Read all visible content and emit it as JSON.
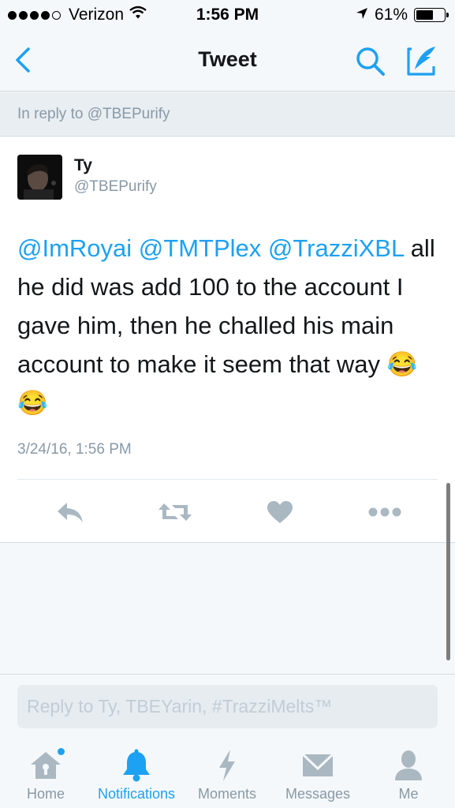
{
  "status_bar": {
    "carrier": "Verizon",
    "time": "1:56 PM",
    "battery_percent": "61%",
    "battery_level": 0.61,
    "signal_dots_filled": 4,
    "signal_dots_total": 5
  },
  "nav": {
    "title": "Tweet",
    "back_icon": "chevron-left-icon",
    "search_icon": "search-icon",
    "compose_icon": "compose-icon"
  },
  "reply_context": "In reply to @TBEPurify",
  "tweet": {
    "name": "Ty",
    "handle": "@TBEPurify",
    "mentions": [
      "@ImRoyai",
      "@TMTPlex",
      "@TrazziXBL"
    ],
    "body": "all he did was add 100 to the account I gave him, then he challed his main account to make it seem that way",
    "emoji": "😂😂",
    "timestamp": "3/24/16, 1:56 PM",
    "actions": [
      "reply-icon",
      "retweet-icon",
      "like-icon",
      "more-icon"
    ]
  },
  "composer": {
    "placeholder": "Reply to Ty, TBEYarin, #TrazziMelts™"
  },
  "tabs": [
    {
      "label": "Home",
      "icon": "home-icon",
      "active": false,
      "badge": true
    },
    {
      "label": "Notifications",
      "icon": "bell-icon",
      "active": true,
      "badge": false
    },
    {
      "label": "Moments",
      "icon": "lightning-icon",
      "active": false,
      "badge": false
    },
    {
      "label": "Messages",
      "icon": "envelope-icon",
      "active": false,
      "badge": false
    },
    {
      "label": "Me",
      "icon": "person-icon",
      "active": false,
      "badge": false
    }
  ],
  "colors": {
    "accent": "#1da1f2",
    "muted": "#8899a6",
    "text": "#14171a",
    "icon_gray": "#aab8c2"
  }
}
